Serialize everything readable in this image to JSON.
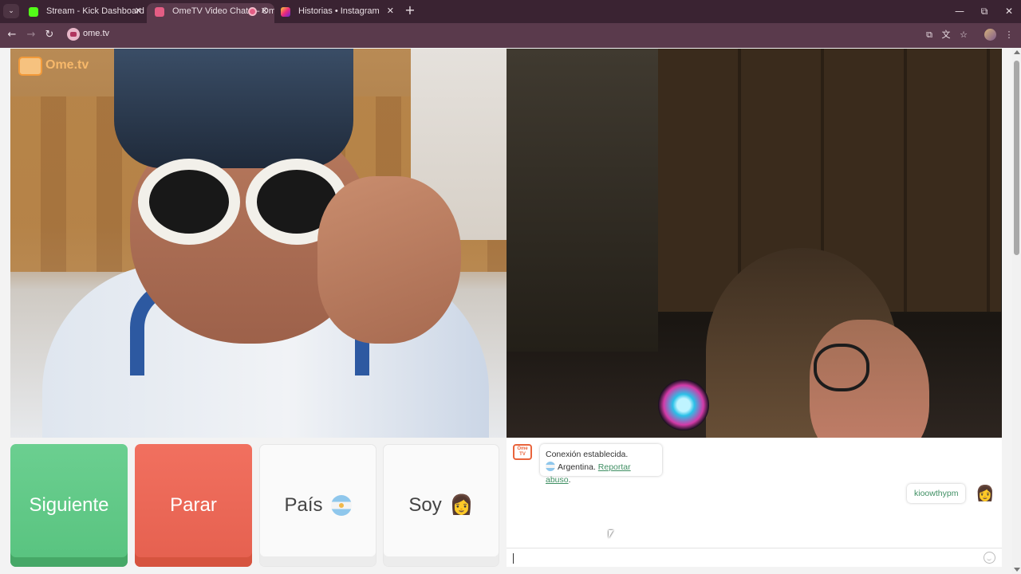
{
  "browser": {
    "tabs": [
      {
        "title": "Stream - Kick Dashboard",
        "favicon_color": "#53fc18"
      },
      {
        "title": "OmeTV Video Chat — Ome",
        "favicon_color": "#e35d84"
      },
      {
        "title": "Historias • Instagram",
        "favicon_color": "#d6249f"
      }
    ],
    "new_tab": "+",
    "url": "ome.tv"
  },
  "logo": {
    "text": "Ome.tv",
    "badge": "Ome TV"
  },
  "buttons": {
    "next": "Siguiente",
    "stop": "Parar",
    "country": "País",
    "gender": "Soy"
  },
  "chat": {
    "system_line1": "Conexión establecida.",
    "country": "Argentina.",
    "report_link": "Reportar abuso",
    "report_suffix": ".",
    "my_message": "kioowthypm",
    "my_emoji": "👩",
    "input_value": "",
    "logo_text": "Ome TV"
  },
  "colors": {
    "next_button": "#58c37f",
    "stop_button": "#e5604f",
    "link_green": "#3f8f63",
    "tab_bar": "#3a2332",
    "toolbar": "#5a3a4c"
  },
  "icons": {
    "gender_emoji": "👩",
    "close_tab": "✕",
    "minimize": "—",
    "maximize": "⧉",
    "close_window": "✕"
  }
}
